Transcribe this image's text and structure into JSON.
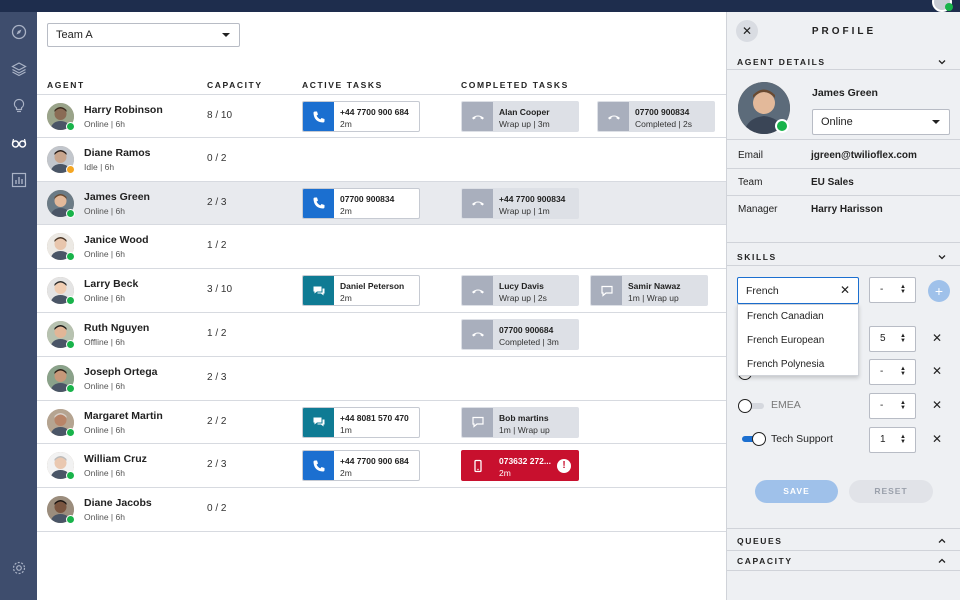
{
  "colors": {
    "topbar": "#1e2d4d",
    "sidenav": "#3e4d6d",
    "voice": "#1b6fd0",
    "chat": "#0f7b94",
    "alert": "#c8102e",
    "online": "#18b34a",
    "idle": "#f5a623"
  },
  "sidenav": {
    "items": [
      {
        "icon": "compass-icon"
      },
      {
        "icon": "layers-icon"
      },
      {
        "icon": "lightbulb-icon"
      },
      {
        "icon": "glasses-icon",
        "active": true
      },
      {
        "icon": "bar-chart-icon"
      }
    ],
    "bottom_icon": "gear-icon"
  },
  "filter": {
    "team_value": "Team A"
  },
  "columns": {
    "agent": "AGENT",
    "capacity": "CAPACITY",
    "active": "ACTIVE TASKS",
    "completed": "COMPLETED TASKS"
  },
  "agents": [
    {
      "name": "Harry Robinson",
      "status": "Online",
      "time": "6h",
      "capacity": "8 / 10",
      "dot": "online",
      "active": [
        {
          "kind": "voice",
          "title": "+44 7700 900 684",
          "sub": "2m"
        }
      ],
      "completed": [
        {
          "kind": "call",
          "title": "Alan Cooper",
          "sub": "Wrap up | 3m"
        },
        {
          "kind": "call",
          "title": "07700 900834",
          "sub": "Completed | 2s"
        }
      ]
    },
    {
      "name": "Diane Ramos",
      "status": "Idle",
      "time": "6h",
      "capacity": "0 / 2",
      "dot": "idle",
      "active": [],
      "completed": []
    },
    {
      "name": "James Green",
      "status": "Online",
      "time": "6h",
      "capacity": "2 / 3",
      "dot": "online",
      "selected": true,
      "active": [
        {
          "kind": "voice",
          "title": "07700 900834",
          "sub": "2m"
        }
      ],
      "completed": [
        {
          "kind": "call",
          "title": "+44 7700 900834",
          "sub": "Wrap up | 1m"
        }
      ]
    },
    {
      "name": "Janice Wood",
      "status": "Online",
      "time": "6h",
      "capacity": "1 / 2",
      "dot": "online",
      "active": [],
      "completed": []
    },
    {
      "name": "Larry Beck",
      "status": "Online",
      "time": "6h",
      "capacity": "3 / 10",
      "dot": "online",
      "active": [
        {
          "kind": "chat",
          "title": "Daniel Peterson",
          "sub": "2m"
        }
      ],
      "completed": [
        {
          "kind": "call",
          "title": "Lucy Davis",
          "sub": "Wrap up | 2s"
        },
        {
          "kind": "chatdone",
          "title": "Samir Nawaz",
          "sub": "1m | Wrap up"
        }
      ]
    },
    {
      "name": "Ruth Nguyen",
      "status": "Offline",
      "time": "6h",
      "capacity": "1 / 2",
      "dot": "online",
      "active": [],
      "completed": [
        {
          "kind": "call",
          "title": "07700 900684",
          "sub": "Completed | 3m"
        }
      ]
    },
    {
      "name": "Joseph Ortega",
      "status": "Online",
      "time": "6h",
      "capacity": "2 / 3",
      "dot": "online",
      "active": [],
      "completed": []
    },
    {
      "name": "Margaret Martin",
      "status": "Online",
      "time": "6h",
      "capacity": "2 / 2",
      "dot": "online",
      "active": [
        {
          "kind": "chat",
          "title": "+44 8081 570 470",
          "sub": "1m"
        }
      ],
      "completed": [
        {
          "kind": "chatdone",
          "title": "Bob martins",
          "sub": "1m | Wrap up"
        }
      ]
    },
    {
      "name": "William Cruz",
      "status": "Online",
      "time": "6h",
      "capacity": "2 / 3",
      "dot": "online",
      "active": [
        {
          "kind": "voice",
          "title": "+44 7700 900 684",
          "sub": "2m"
        }
      ],
      "completed": [
        {
          "kind": "alert",
          "title": "073632 272...",
          "sub": "2m"
        }
      ]
    },
    {
      "name": "Diane Jacobs",
      "status": "Online",
      "time": "6h",
      "capacity": "0 / 2",
      "dot": "online",
      "active": [],
      "completed": []
    }
  ],
  "panel": {
    "title": "PROFILE",
    "agent_details": "AGENT DETAILS",
    "name": "James Green",
    "status_value": "Online",
    "email_label": "Email",
    "email_value": "jgreen@twilioflex.com",
    "team_label": "Team",
    "team_value": "EU Sales",
    "manager_label": "Manager",
    "manager_value": "Harry Harisson",
    "skills": "SKILLS",
    "skill_search_value": "French",
    "new_skill_level": "-",
    "suggestions": [
      "French Canadian",
      "French European",
      "French Polynesia"
    ],
    "skill_rows": [
      {
        "label": "",
        "level": "5",
        "on": true
      },
      {
        "label": "",
        "level": "-",
        "on": false
      },
      {
        "label": "EMEA",
        "level": "-",
        "on": false
      },
      {
        "label": "Tech Support",
        "level": "1",
        "on": true
      }
    ],
    "save": "SAVE",
    "reset": "RESET",
    "queues": "QUEUES",
    "capacity": "CAPACITY"
  }
}
